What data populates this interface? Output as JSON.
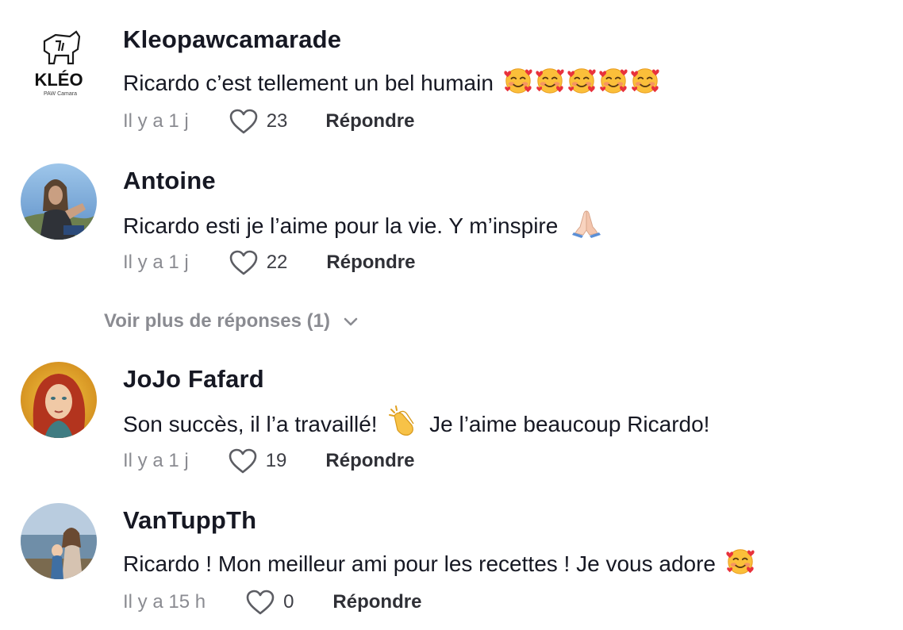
{
  "comments": [
    {
      "username": "Kleopawcamarade",
      "text": "Ricardo c’est tellement un bel humain",
      "emojis": [
        "smiling-face-with-hearts",
        "smiling-face-with-hearts",
        "smiling-face-with-hearts",
        "smiling-face-with-hearts",
        "smiling-face-with-hearts"
      ],
      "time": "Il y a 1 j",
      "likes": "23",
      "reply_label": "Répondre",
      "avatar": {
        "logo_text": "KLÉO",
        "logo_subtext": "PAW Camara"
      }
    },
    {
      "username": "Antoine",
      "text": "Ricardo esti je l’aime pour la vie. Y m’inspire",
      "emojis": [
        "folded-hands"
      ],
      "time": "Il y a 1 j",
      "likes": "22",
      "reply_label": "Répondre"
    },
    {
      "username": "JoJo Fafard",
      "text_before": "Son succès, il l’a travaillé!",
      "emojis": [
        "clapping-hands"
      ],
      "text_after": "Je l’aime beaucoup Ricardo!",
      "time": "Il y a 1 j",
      "likes": "19",
      "reply_label": "Répondre"
    },
    {
      "username": "VanTuppTh",
      "text": "Ricardo ! Mon meilleur ami pour les recettes ! Je vous adore",
      "emojis": [
        "smiling-face-with-hearts"
      ],
      "time": "Il y a 15 h",
      "likes": "0",
      "reply_label": "Répondre"
    }
  ],
  "more_replies": {
    "label": "Voir plus de réponses (1)",
    "icon": "chevron-down-icon"
  },
  "colors": {
    "text": "#161823",
    "secondary": "#8a8b91",
    "reply": "#2f3036"
  }
}
